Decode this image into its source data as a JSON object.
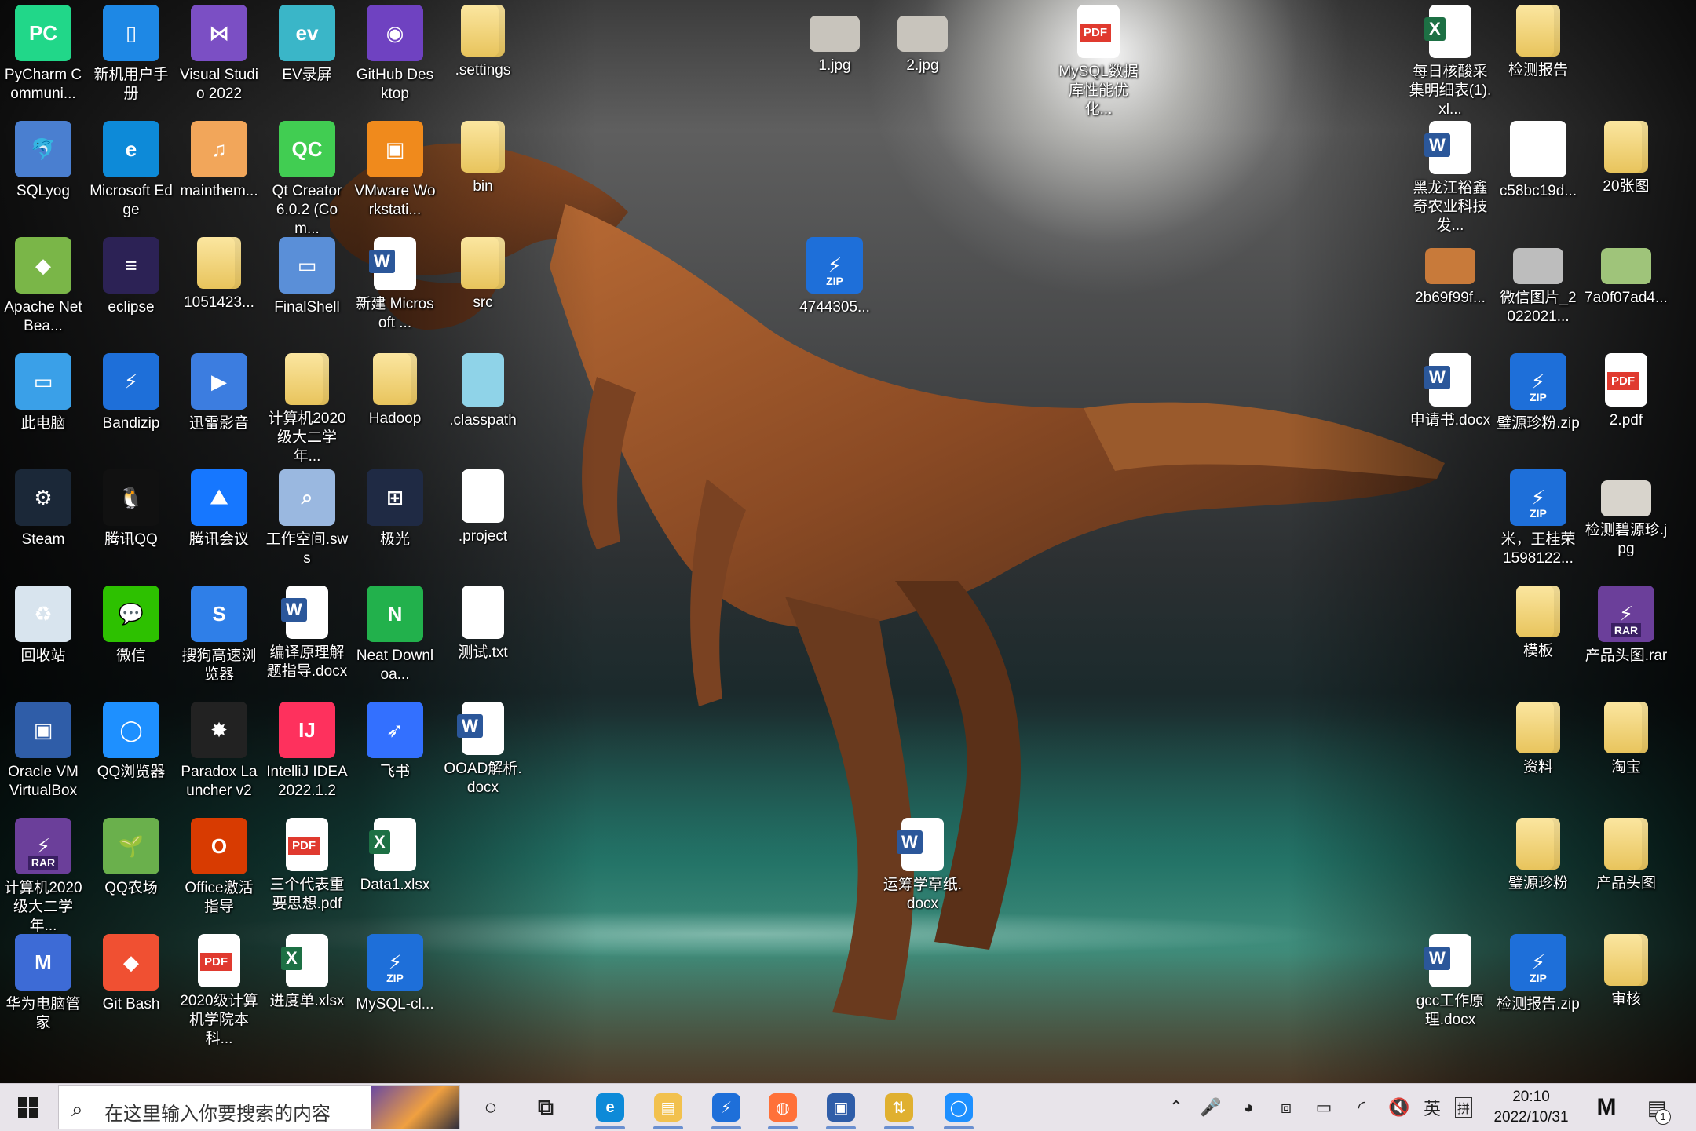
{
  "desktop": {
    "icons": [
      {
        "label": "PyCharm Communi...",
        "icon": "pycharm-icon",
        "color": "#21d789",
        "glyph": "PC"
      },
      {
        "label": "新机用户手册",
        "icon": "manual-icon",
        "color": "#1e88e5",
        "glyph": "▯"
      },
      {
        "label": "Visual Studio 2022",
        "icon": "visual-studio-icon",
        "color": "#7b4fc4",
        "glyph": "⋈"
      },
      {
        "label": "EV录屏",
        "icon": "ev-recorder-icon",
        "color": "#3ab6c8",
        "glyph": "ev"
      },
      {
        "label": "GitHub Desktop",
        "icon": "github-desktop-icon",
        "color": "#6f42c1",
        "glyph": "◉"
      },
      {
        "label": ".settings",
        "icon": "folder-icon",
        "color": "#f2d27a",
        "glyph": ""
      },
      {
        "label": "SQLyog",
        "icon": "sqlyog-icon",
        "color": "#4a7fd0",
        "glyph": "🐬"
      },
      {
        "label": "Microsoft Edge",
        "icon": "edge-icon",
        "color": "#0d8ad8",
        "glyph": "e"
      },
      {
        "label": "mainthem...",
        "icon": "audio-file-icon",
        "color": "#f2a65a",
        "glyph": "♫"
      },
      {
        "label": "Qt Creator 6.0.2 (Com...",
        "icon": "qt-creator-icon",
        "color": "#41cd52",
        "glyph": "QC"
      },
      {
        "label": "VMware Workstati...",
        "icon": "vmware-icon",
        "color": "#f08a1c",
        "glyph": "▣"
      },
      {
        "label": "bin",
        "icon": "folder-icon",
        "color": "#f2d27a",
        "glyph": ""
      },
      {
        "label": "Apache NetBea...",
        "icon": "netbeans-icon",
        "color": "#7ab648",
        "glyph": "◆"
      },
      {
        "label": "eclipse",
        "icon": "eclipse-icon",
        "color": "#2c2255",
        "glyph": "≡"
      },
      {
        "label": "1051423...",
        "icon": "folder-icon",
        "color": "#f2d27a",
        "glyph": ""
      },
      {
        "label": "FinalShell",
        "icon": "finalshell-icon",
        "color": "#5a8fd8",
        "glyph": "▭"
      },
      {
        "label": "新建 Microsoft ...",
        "icon": "word-doc-icon",
        "color": "#2b579a",
        "glyph": "W"
      },
      {
        "label": "src",
        "icon": "folder-icon",
        "color": "#f2d27a",
        "glyph": ""
      },
      {
        "label": "4744305...",
        "icon": "zip-icon",
        "color": "#1e6fd9",
        "glyph": "ZIP"
      },
      {
        "label": "此电脑",
        "icon": "this-pc-icon",
        "color": "#3aa0e8",
        "glyph": "▭"
      },
      {
        "label": "Bandizip",
        "icon": "bandizip-icon",
        "color": "#1e6fd9",
        "glyph": "⚡"
      },
      {
        "label": "迅雷影音",
        "icon": "xunlei-player-icon",
        "color": "#3c7de0",
        "glyph": "▶"
      },
      {
        "label": "计算机2020 级大二学年...",
        "icon": "folder-icon",
        "color": "#f2d27a",
        "glyph": ""
      },
      {
        "label": "Hadoop",
        "icon": "folder-icon",
        "color": "#f2d27a",
        "glyph": ""
      },
      {
        "label": ".classpath",
        "icon": "classpath-file-icon",
        "color": "#8fd3e8",
        "glyph": ""
      },
      {
        "label": "Steam",
        "icon": "steam-icon",
        "color": "#1b2838",
        "glyph": "⚙"
      },
      {
        "label": "腾讯QQ",
        "icon": "qq-icon",
        "color": "#111111",
        "glyph": "🐧"
      },
      {
        "label": "腾讯会议",
        "icon": "tencent-meeting-icon",
        "color": "#1677ff",
        "glyph": "⛰"
      },
      {
        "label": "工作空间.sws",
        "icon": "workspace-file-icon",
        "color": "#9ab8e0",
        "glyph": "⌕"
      },
      {
        "label": "极光",
        "icon": "jiguang-icon",
        "color": "#1f2a44",
        "glyph": "⊞"
      },
      {
        "label": ".project",
        "icon": "blank-file-icon",
        "color": "#ffffff",
        "glyph": ""
      },
      {
        "label": "回收站",
        "icon": "recycle-bin-icon",
        "color": "#d8e4ee",
        "glyph": "♻"
      },
      {
        "label": "微信",
        "icon": "wechat-icon",
        "color": "#2dc100",
        "glyph": "💬"
      },
      {
        "label": "搜狗高速浏览器",
        "icon": "sogou-browser-icon",
        "color": "#2f7fe8",
        "glyph": "S"
      },
      {
        "label": "编译原理解题指导.docx",
        "icon": "word-doc-icon",
        "color": "#2b579a",
        "glyph": "W"
      },
      {
        "label": "Neat Downloa...",
        "icon": "neat-download-icon",
        "color": "#22b14c",
        "glyph": "N"
      },
      {
        "label": "测试.txt",
        "icon": "text-file-icon",
        "color": "#ffffff",
        "glyph": ""
      },
      {
        "label": "Oracle VM VirtualBox",
        "icon": "virtualbox-icon",
        "color": "#2f5da8",
        "glyph": "▣"
      },
      {
        "label": "QQ浏览器",
        "icon": "qq-browser-icon",
        "color": "#1e90ff",
        "glyph": "◯"
      },
      {
        "label": "Paradox Launcher v2",
        "icon": "paradox-icon",
        "color": "#222222",
        "glyph": "✸"
      },
      {
        "label": "IntelliJ IDEA 2022.1.2",
        "icon": "intellij-icon",
        "color": "#fe315d",
        "glyph": "IJ"
      },
      {
        "label": "飞书",
        "icon": "feishu-icon",
        "color": "#3370ff",
        "glyph": "➶"
      },
      {
        "label": "OOAD解析.docx",
        "icon": "word-doc-icon",
        "color": "#2b579a",
        "glyph": "W"
      },
      {
        "label": "计算机2020 级大二学年...",
        "icon": "rar-icon",
        "color": "#6b3f9a",
        "glyph": "RAR"
      },
      {
        "label": "QQ农场",
        "icon": "qq-farm-icon",
        "color": "#6ab04c",
        "glyph": "🌱"
      },
      {
        "label": "Office激活指导",
        "icon": "office-icon",
        "color": "#d83b01",
        "glyph": "O"
      },
      {
        "label": "三个代表重要思想.pdf",
        "icon": "pdf-icon",
        "color": "#e03a2f",
        "glyph": "PDF"
      },
      {
        "label": "Data1.xlsx",
        "icon": "excel-icon",
        "color": "#1d7044",
        "glyph": "X"
      },
      {
        "label": "华为电脑管家",
        "icon": "huawei-pc-manager-icon",
        "color": "#3d6bd6",
        "glyph": "M"
      },
      {
        "label": "Git Bash",
        "icon": "git-bash-icon",
        "color": "#f05032",
        "glyph": "◆"
      },
      {
        "label": "2020级计算机学院本科...",
        "icon": "pdf-icon",
        "color": "#e03a2f",
        "glyph": "PDF"
      },
      {
        "label": "进度单.xlsx",
        "icon": "excel-icon",
        "color": "#1d7044",
        "glyph": "X"
      },
      {
        "label": "MySQL-cl...",
        "icon": "zip-icon",
        "color": "#1e6fd9",
        "glyph": "ZIP"
      },
      {
        "label": "1.jpg",
        "icon": "image-file-icon",
        "color": "#c8c4bc",
        "glyph": ""
      },
      {
        "label": "2.jpg",
        "icon": "image-file-icon",
        "color": "#c8c4bc",
        "glyph": ""
      },
      {
        "label": "MySQL数据库性能优化...",
        "icon": "pdf-icon",
        "color": "#e03a2f",
        "glyph": "PDF"
      },
      {
        "label": "运筹学草纸.docx",
        "icon": "word-doc-icon",
        "color": "#2b579a",
        "glyph": "W"
      },
      {
        "label": "每日核酸采集明细表(1).xl...",
        "icon": "excel-icon",
        "color": "#1d7044",
        "glyph": "X"
      },
      {
        "label": "检测报告",
        "icon": "folder-icon",
        "color": "#f2d27a",
        "glyph": ""
      },
      {
        "label": "黑龙江裕鑫奇农业科技发...",
        "icon": "word-doc-icon",
        "color": "#2b579a",
        "glyph": "W"
      },
      {
        "label": "c58bc19d...",
        "icon": "qr-image-icon",
        "color": "#ffffff",
        "glyph": "▦"
      },
      {
        "label": "20张图",
        "icon": "folder-icon",
        "color": "#f2d27a",
        "glyph": ""
      },
      {
        "label": "2b69f99f...",
        "icon": "image-file-icon",
        "color": "#c87a3a",
        "glyph": ""
      },
      {
        "label": "微信图片_2022021...",
        "icon": "image-file-icon",
        "color": "#bdbdbd",
        "glyph": ""
      },
      {
        "label": "7a0f07ad4...",
        "icon": "image-file-icon",
        "color": "#9fc47a",
        "glyph": ""
      },
      {
        "label": "申请书.docx",
        "icon": "word-doc-icon",
        "color": "#2b579a",
        "glyph": "W"
      },
      {
        "label": "璧源珍粉.zip",
        "icon": "zip-icon",
        "color": "#1e6fd9",
        "glyph": "ZIP"
      },
      {
        "label": "2.pdf",
        "icon": "pdf-icon",
        "color": "#e03a2f",
        "glyph": "PDF"
      },
      {
        "label": "米，王桂荣 1598122...",
        "icon": "zip-icon",
        "color": "#1e6fd9",
        "glyph": "ZIP"
      },
      {
        "label": "检测碧源珍.jpg",
        "icon": "image-file-icon",
        "color": "#d8d4cc",
        "glyph": ""
      },
      {
        "label": "模板",
        "icon": "folder-icon",
        "color": "#f2d27a",
        "glyph": ""
      },
      {
        "label": "产品头图.rar",
        "icon": "rar-icon",
        "color": "#6b3f9a",
        "glyph": "RAR"
      },
      {
        "label": "资料",
        "icon": "folder-icon",
        "color": "#f2d27a",
        "glyph": ""
      },
      {
        "label": "淘宝",
        "icon": "folder-icon",
        "color": "#f2d27a",
        "glyph": ""
      },
      {
        "label": "璧源珍粉",
        "icon": "folder-icon",
        "color": "#f2d27a",
        "glyph": ""
      },
      {
        "label": "产品头图",
        "icon": "folder-icon",
        "color": "#f2d27a",
        "glyph": ""
      },
      {
        "label": "gcc工作原理.docx",
        "icon": "word-doc-icon",
        "color": "#2b579a",
        "glyph": "W"
      },
      {
        "label": "检测报告.zip",
        "icon": "zip-icon",
        "color": "#1e6fd9",
        "glyph": "ZIP"
      },
      {
        "label": "审核",
        "icon": "folder-icon",
        "color": "#f2d27a",
        "glyph": ""
      }
    ]
  },
  "taskbar": {
    "search_placeholder": "在这里输入你要搜索的内容",
    "apps": [
      {
        "icon": "cortana-icon",
        "glyph": "○",
        "color": "#222222"
      },
      {
        "icon": "task-view-icon",
        "glyph": "⧉",
        "color": "#222222"
      },
      {
        "icon": "edge-taskbar-icon",
        "glyph": "e",
        "color": "#0d8ad8"
      },
      {
        "icon": "file-explorer-icon",
        "glyph": "▤",
        "color": "#f2c14e"
      },
      {
        "icon": "bandizip-taskbar-icon",
        "glyph": "⚡",
        "color": "#1e6fd9"
      },
      {
        "icon": "firefox-icon",
        "glyph": "◍",
        "color": "#ff7139"
      },
      {
        "icon": "virtualbox-taskbar-icon",
        "glyph": "▣",
        "color": "#2f5da8"
      },
      {
        "icon": "winscp-icon",
        "glyph": "⇅",
        "color": "#e0b030"
      },
      {
        "icon": "qq-browser-taskbar-icon",
        "glyph": "◯",
        "color": "#1e90ff"
      }
    ],
    "tray": {
      "language": "英",
      "input_mode": "拼",
      "time": "20:10",
      "date": "2022/10/31",
      "notification_count": "1"
    }
  }
}
